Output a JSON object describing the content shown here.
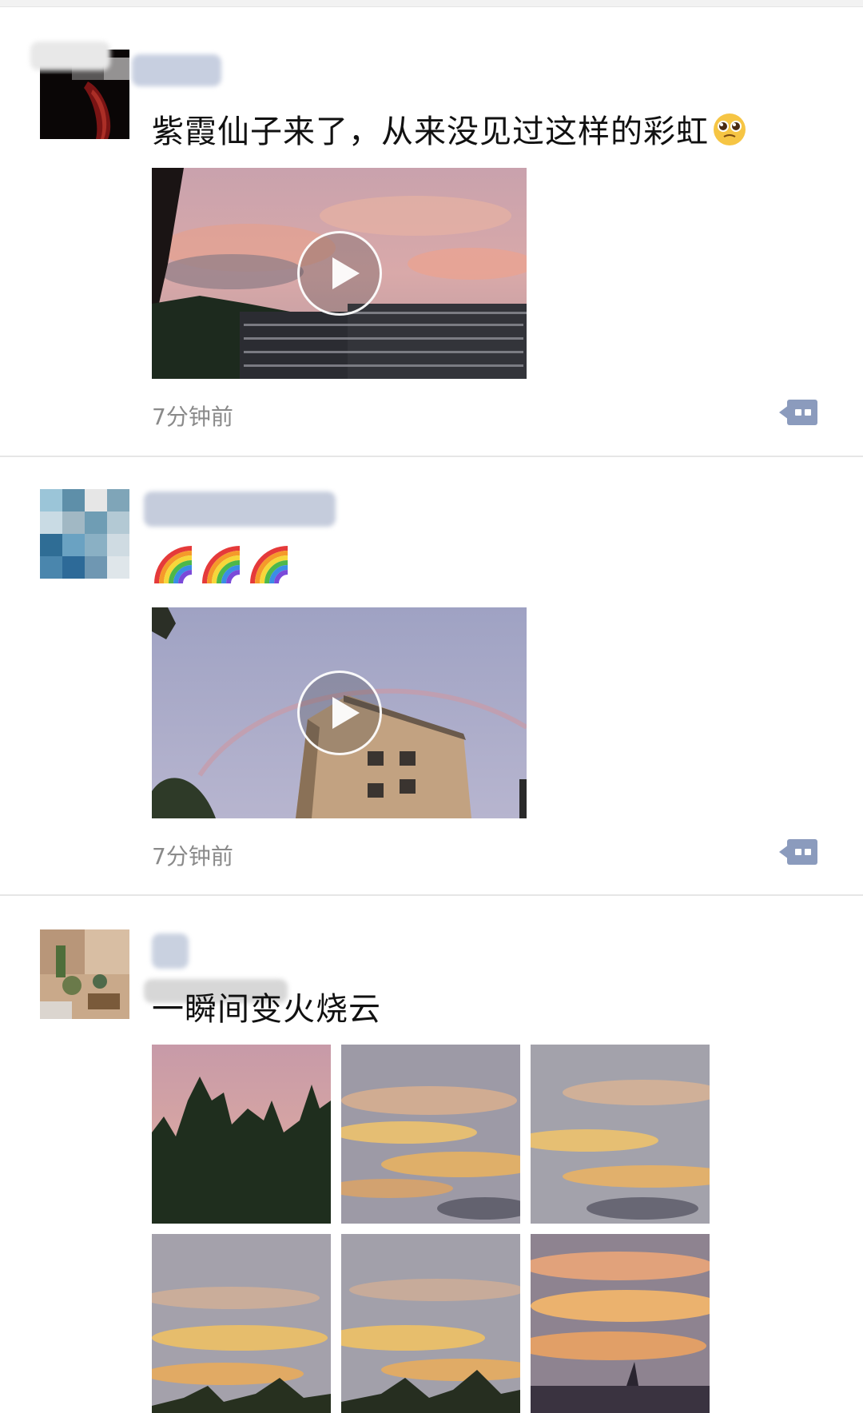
{
  "posts": [
    {
      "username": "",
      "text": "紫霞仙子来了，从来没见过这样的彩虹",
      "media": "video",
      "time": "7分钟前"
    },
    {
      "username": "",
      "text": "",
      "media": "video",
      "time": "7分钟前"
    },
    {
      "username": "",
      "text": "一瞬间变火烧云",
      "media": "photo-grid"
    }
  ],
  "icons": {
    "play": "play-icon",
    "comment": "comment-icon",
    "emoji_pleading": "pleading-face-emoji",
    "rainbow": "rainbow-emoji"
  },
  "colors": {
    "divider": "#e6e6e6",
    "time_text": "#8a8a8a",
    "comment_icon": "#8b9bbd",
    "body_text": "#111111"
  }
}
